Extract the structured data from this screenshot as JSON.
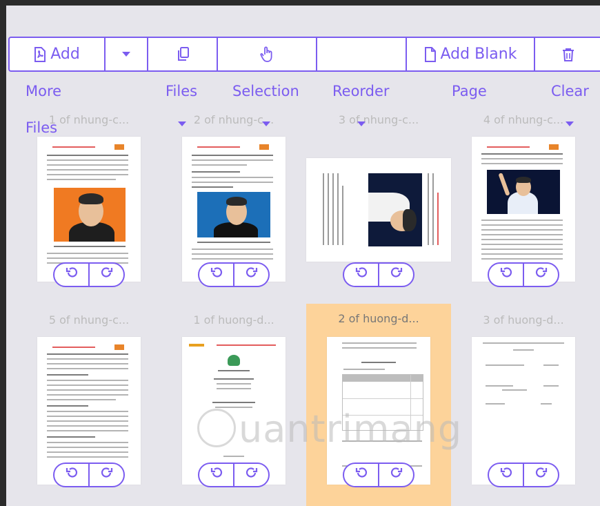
{
  "toolbar": {
    "add_label": "Add",
    "add_blank_label": "Add Blank",
    "sublabels": {
      "more": "More",
      "files_row1": "Files",
      "files_row2": "Files",
      "selection": "Selection",
      "reorder": "Reorder",
      "page": "Page",
      "clear": "Clear"
    }
  },
  "pages": [
    {
      "title": "1 of nhung-c..."
    },
    {
      "title": "2 of nhung-c..."
    },
    {
      "title": "3 of nhung-c..."
    },
    {
      "title": "4 of nhung-c..."
    },
    {
      "title": "5 of nhung-c..."
    },
    {
      "title": "1 of huong-d..."
    },
    {
      "title": "2 of huong-d...",
      "selected": true
    },
    {
      "title": "3 of huong-d..."
    }
  ],
  "colors": {
    "accent": "#7b5cf0",
    "selected_background": "#fdd39a",
    "workspace_background": "#e6e5eb"
  },
  "watermark": "uantrimang"
}
